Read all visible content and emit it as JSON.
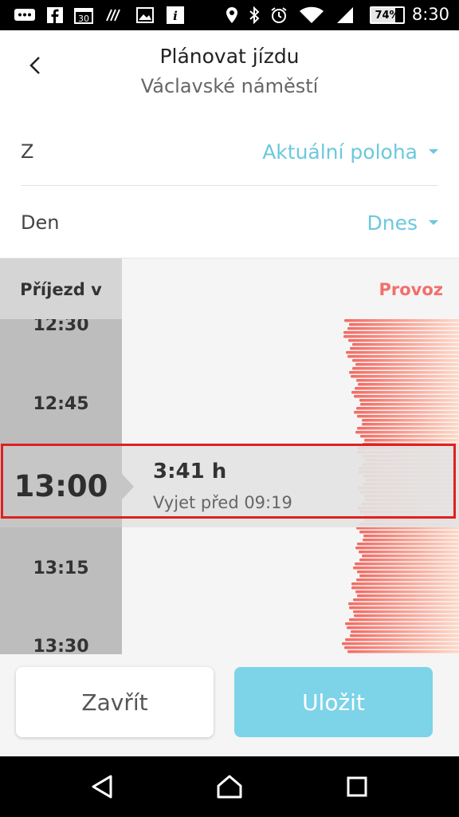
{
  "status_bar": {
    "time": "8:30",
    "battery": "74%",
    "battery_level": 0.74,
    "notification_badge": "30",
    "icons": [
      "message-icon",
      "facebook-icon",
      "calendar-icon",
      "nfc-icon",
      "image-icon",
      "info-icon",
      "location-icon",
      "bluetooth-icon",
      "alarm-icon",
      "wifi-icon",
      "signal-icon"
    ]
  },
  "header": {
    "title": "Plánovat jízdu",
    "subtitle": "Václavské náměstí"
  },
  "from_row": {
    "label": "Z",
    "value": "Aktuální poloha"
  },
  "day_row": {
    "label": "Den",
    "value": "Dnes"
  },
  "table": {
    "arrival_header": "Příjezd v",
    "traffic_header": "Provoz",
    "times": [
      "12:30",
      "12:45",
      "13:15",
      "13:30"
    ],
    "selected": {
      "time": "13:00",
      "duration": "3:41 h",
      "departure": "Vyjet před 09:19"
    }
  },
  "footer": {
    "close_label": "Zavřít",
    "save_label": "Uložit"
  },
  "colors": {
    "accent": "#6cc8de",
    "save_button": "#7dd3e8",
    "traffic": "#f57a72",
    "highlight_box": "#e02020"
  }
}
